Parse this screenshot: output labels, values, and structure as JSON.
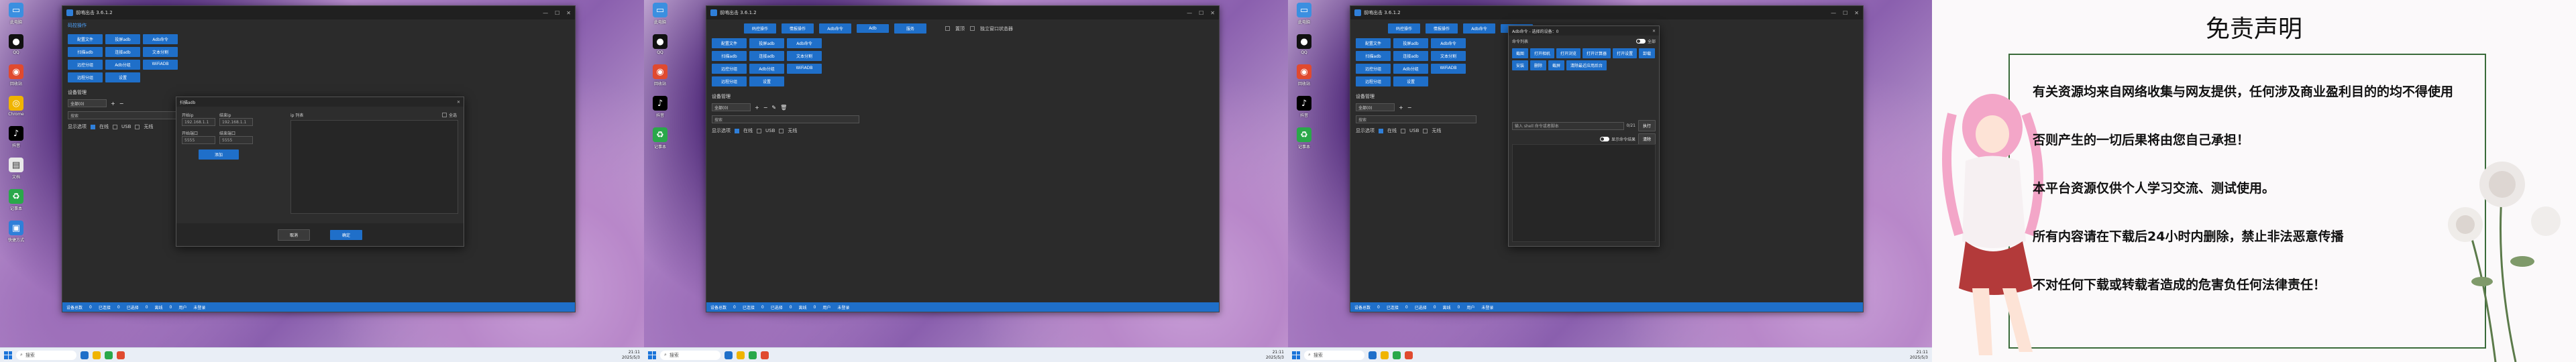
{
  "app": {
    "title": "前哨出击 3.6.1.2",
    "window_controls": [
      "—",
      "☐",
      "✕"
    ],
    "tabs": [
      "码控操作",
      "情报操作",
      "Adb命令",
      "Adb",
      "服务"
    ],
    "tools": [
      "配置文件",
      "投屏adb",
      "Adb命令",
      "扫描adb",
      "连接adb",
      "文本分割",
      "远控分组",
      "Adb分组",
      "ADB控制",
      "远程分组",
      "设置",
      "WiFiADB"
    ],
    "checkbox_labels": {
      "top": "置顶",
      "remember": "独立窗口状态器"
    },
    "list_section": "设备管理",
    "group_select": "全部(0)",
    "search_placeholder": "搜索",
    "filter": {
      "label": "显示选项",
      "items": [
        "在线",
        "USB",
        "无线"
      ]
    },
    "status": [
      "设备总数",
      "0",
      "已连接",
      "0",
      "已选择",
      "0",
      "离线",
      "0",
      "用户",
      "未登录"
    ]
  },
  "scan_dialog": {
    "title": "扫描adb",
    "start_ip_label": "开始ip",
    "end_ip_label": "结束ip",
    "start_ip": "192.168.1.1",
    "end_ip": "192.168.1.1",
    "start_port_label": "开始端口",
    "end_port_label": "结束端口",
    "start_port": "5555",
    "end_port": "5555",
    "add_button": "添加",
    "list_header": "ip 列表",
    "select_all": "全选",
    "cancel": "取消",
    "confirm": "确定"
  },
  "adb_dialog": {
    "title": "Adb命令 - 选择的设备：0",
    "section": "命令列表",
    "switch_label": "全部",
    "commands": [
      "截图",
      "打开相机",
      "打开浏览",
      "打开计算器",
      "打开设置",
      "卸载",
      "安装",
      "删除",
      "截屏",
      "清除最近应用后台",
      "命令集合",
      "导出"
    ],
    "input_placeholder": "输入 shell 命令或者脚本",
    "exec_button": "执行",
    "clear_button": "清除",
    "count_text": "0/21",
    "show_result": "显示命令结果"
  },
  "taskbar": {
    "search": "搜索",
    "time": "21:11",
    "date": "2025/5/3"
  },
  "desktop_icons": [
    "此电脑",
    "QQ",
    "回收站",
    "Chrome",
    "抖音",
    "微信",
    "网易",
    "文档",
    "记事本",
    "快捷方式"
  ],
  "notice": {
    "title": "免责声明",
    "lines": [
      "有关资源均来自网络收集与网友提供，任何涉及商业盈利目的的均不得使用",
      "否则产生的一切后果将由您自己承担！",
      "本平台资源仅供个人学习交流、测试使用。",
      "所有内容请在下载后24小时内删除，禁止非法恶意传播",
      "不对任何下载或转载者造成的危害负任何法律责任！"
    ]
  },
  "colors": {
    "accent": "#1f6fc9",
    "window_bg": "#2b2b2b",
    "frame": "#3a6b3a"
  }
}
